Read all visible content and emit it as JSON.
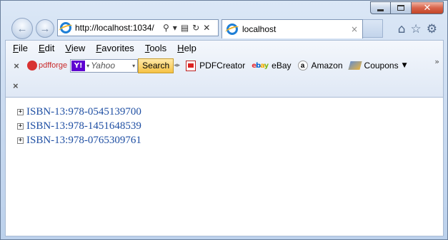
{
  "browser": {
    "address": {
      "url": "http://localhost:1034/"
    },
    "tab": {
      "title": "localhost",
      "close_glyph": "×"
    },
    "nav": {
      "back_glyph": "←",
      "forward_glyph": "→"
    },
    "right_icons": {
      "home": "⌂",
      "favorites": "☆",
      "settings": "⚙"
    },
    "caption": {
      "close_glyph": "✕"
    }
  },
  "menu": {
    "items": [
      "File",
      "Edit",
      "View",
      "Favorites",
      "Tools",
      "Help"
    ]
  },
  "toolbar": {
    "close_glyph": "×",
    "pdfforge_label": "pdfforge",
    "search": {
      "provider_badge": "Y!",
      "placeholder": "Yahoo",
      "button_label": "Search"
    },
    "items": [
      {
        "label": "PDFCreator",
        "icon": "pdf-icon"
      },
      {
        "label": "eBay",
        "icon": "ebay-icon"
      },
      {
        "label": "Amazon",
        "icon": "amazon-icon"
      },
      {
        "label": "Coupons",
        "icon": "coupon-icon"
      }
    ],
    "overflow_glyph": "»"
  },
  "toolbar2": {
    "close_glyph": "×"
  },
  "tree": {
    "expander_glyph": "+",
    "nodes": [
      {
        "label": "ISBN-13:978-0545139700"
      },
      {
        "label": "ISBN-13:978-1451648539"
      },
      {
        "label": "ISBN-13:978-0765309761"
      }
    ]
  },
  "colors": {
    "link": "#1f4fa3",
    "close_button": "#c24527",
    "search_button": "#f6c244"
  }
}
